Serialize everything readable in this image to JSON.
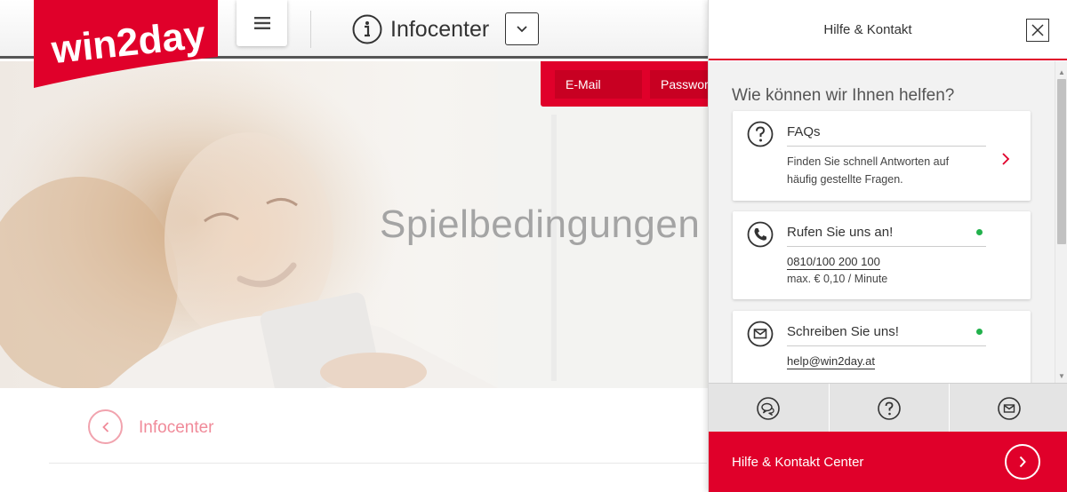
{
  "brand": {
    "logo_text": "win2day",
    "accent_color": "#e0002a"
  },
  "header": {
    "menu_icon": "hamburger-menu-icon",
    "info_icon": "info-circle-icon",
    "title": "Infocenter",
    "dropdown_icon": "chevron-down-icon"
  },
  "login": {
    "email_placeholder": "E-Mail",
    "password_placeholder": "Passwort"
  },
  "hero": {
    "title": "Spielbedingungen"
  },
  "breadcrumb": {
    "back_icon": "chevron-left-icon",
    "label": "Infocenter"
  },
  "help_panel": {
    "title": "Hilfe & Kontakt",
    "close_icon": "close-icon",
    "question": "Wie können wir Ihnen helfen?",
    "cards": [
      {
        "icon": "question-circle-icon",
        "title": "FAQs",
        "lines": [
          "Finden Sie schnell Antworten auf",
          "häufig gestellte Fragen."
        ]
      },
      {
        "icon": "phone-icon",
        "title": "Rufen Sie uns an!",
        "phone": "0810/100 200 100",
        "price": "max. € 0,10 / Minute",
        "status_color": "#22b14c"
      },
      {
        "icon": "mail-icon",
        "title": "Schreiben Sie uns!",
        "email": "help@win2day.at",
        "status_color": "#22b14c"
      }
    ],
    "quick_actions": [
      {
        "icon": "chat-icon"
      },
      {
        "icon": "question-circle-icon"
      },
      {
        "icon": "mail-icon"
      }
    ],
    "cta_label": "Hilfe & Kontakt Center",
    "cta_icon": "chevron-right-circle-icon"
  }
}
